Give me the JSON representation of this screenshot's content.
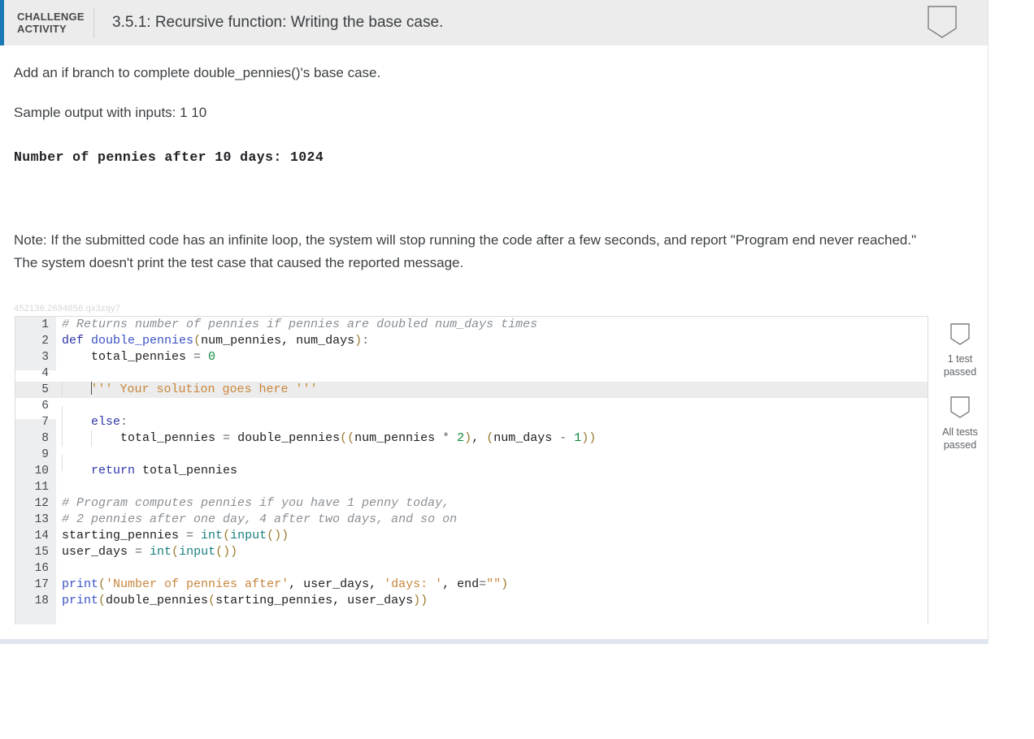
{
  "header": {
    "kicker": "CHALLENGE ACTIVITY",
    "title": "3.5.1: Recursive function: Writing the base case.",
    "badge_icon": "trophy-shield-icon",
    "accent_color": "#1b7ab5"
  },
  "prompt": {
    "instruction": "Add an if branch to complete double_pennies()'s base case.",
    "sample_output_label": "Sample output with inputs: 1 10",
    "sample_output_text": "Number of pennies after 10 days: 1024",
    "note": "Note: If the submitted code has an infinite loop, the system will stop running the code after a few seconds, and report \"Program end never reached.\" The system doesn't print the test case that caused the reported message."
  },
  "editor": {
    "submission_id": "452136.2694856.qx3zqy7",
    "highlighted_line": 5,
    "editable_lines": [
      4,
      5,
      6
    ],
    "lines": [
      {
        "n": "1",
        "tokens": [
          {
            "t": "comment",
            "v": "# Returns number of pennies if pennies are doubled num_days times"
          }
        ]
      },
      {
        "n": "2",
        "tokens": [
          {
            "t": "keyword",
            "v": "def"
          },
          {
            "t": "plain",
            "v": " "
          },
          {
            "t": "func",
            "v": "double_pennies"
          },
          {
            "t": "paren",
            "v": "("
          },
          {
            "t": "plain",
            "v": "num_pennies, num_days"
          },
          {
            "t": "paren",
            "v": ")"
          },
          {
            "t": "op",
            "v": ":"
          }
        ]
      },
      {
        "n": "3",
        "tokens": [
          {
            "t": "plain",
            "v": "    total_pennies "
          },
          {
            "t": "op",
            "v": "= "
          },
          {
            "t": "num",
            "v": "0"
          }
        ]
      },
      {
        "n": "4",
        "tokens": []
      },
      {
        "n": "5",
        "tokens": [
          {
            "t": "plain",
            "v": "    "
          },
          {
            "t": "caret",
            "v": ""
          },
          {
            "t": "str",
            "v": "''' Your solution goes here '''"
          }
        ]
      },
      {
        "n": "6",
        "tokens": []
      },
      {
        "n": "7",
        "tokens": [
          {
            "t": "plain",
            "v": "    "
          },
          {
            "t": "keyword",
            "v": "else"
          },
          {
            "t": "op",
            "v": ":"
          }
        ]
      },
      {
        "n": "8",
        "tokens": [
          {
            "t": "plain",
            "v": "        total_pennies "
          },
          {
            "t": "op",
            "v": "= "
          },
          {
            "t": "plain",
            "v": "double_pennies"
          },
          {
            "t": "paren",
            "v": "(("
          },
          {
            "t": "plain",
            "v": "num_pennies "
          },
          {
            "t": "op",
            "v": "* "
          },
          {
            "t": "num",
            "v": "2"
          },
          {
            "t": "paren",
            "v": ")"
          },
          {
            "t": "plain",
            "v": ", "
          },
          {
            "t": "paren",
            "v": "("
          },
          {
            "t": "plain",
            "v": "num_days "
          },
          {
            "t": "op",
            "v": "- "
          },
          {
            "t": "num",
            "v": "1"
          },
          {
            "t": "paren",
            "v": "))"
          }
        ]
      },
      {
        "n": "9",
        "tokens": []
      },
      {
        "n": "10",
        "tokens": [
          {
            "t": "plain",
            "v": "    "
          },
          {
            "t": "keyword",
            "v": "return"
          },
          {
            "t": "plain",
            "v": " total_pennies"
          }
        ]
      },
      {
        "n": "11",
        "tokens": []
      },
      {
        "n": "12",
        "tokens": [
          {
            "t": "comment",
            "v": "# Program computes pennies if you have 1 penny today,"
          }
        ]
      },
      {
        "n": "13",
        "tokens": [
          {
            "t": "comment",
            "v": "# 2 pennies after one day, 4 after two days, and so on"
          }
        ]
      },
      {
        "n": "14",
        "tokens": [
          {
            "t": "plain",
            "v": "starting_pennies "
          },
          {
            "t": "op",
            "v": "= "
          },
          {
            "t": "builtin",
            "v": "int"
          },
          {
            "t": "paren",
            "v": "("
          },
          {
            "t": "builtin",
            "v": "input"
          },
          {
            "t": "paren",
            "v": "())"
          }
        ]
      },
      {
        "n": "15",
        "tokens": [
          {
            "t": "plain",
            "v": "user_days "
          },
          {
            "t": "op",
            "v": "= "
          },
          {
            "t": "builtin",
            "v": "int"
          },
          {
            "t": "paren",
            "v": "("
          },
          {
            "t": "builtin",
            "v": "input"
          },
          {
            "t": "paren",
            "v": "())"
          }
        ]
      },
      {
        "n": "16",
        "tokens": []
      },
      {
        "n": "17",
        "tokens": [
          {
            "t": "func",
            "v": "print"
          },
          {
            "t": "paren",
            "v": "("
          },
          {
            "t": "str",
            "v": "'Number of pennies after'"
          },
          {
            "t": "plain",
            "v": ", user_days, "
          },
          {
            "t": "str",
            "v": "'days: '"
          },
          {
            "t": "plain",
            "v": ", end"
          },
          {
            "t": "op",
            "v": "="
          },
          {
            "t": "str",
            "v": "\"\""
          },
          {
            "t": "paren",
            "v": ")"
          }
        ]
      },
      {
        "n": "18",
        "tokens": [
          {
            "t": "func",
            "v": "print"
          },
          {
            "t": "paren",
            "v": "("
          },
          {
            "t": "plain",
            "v": "double_pennies"
          },
          {
            "t": "paren",
            "v": "("
          },
          {
            "t": "plain",
            "v": "starting_pennies, user_days"
          },
          {
            "t": "paren",
            "v": "))"
          }
        ]
      }
    ]
  },
  "right_rail": {
    "items": [
      {
        "icon": "trophy-shield-icon",
        "label": "1 test passed"
      },
      {
        "icon": "trophy-shield-icon",
        "label": "All tests passed"
      }
    ]
  }
}
